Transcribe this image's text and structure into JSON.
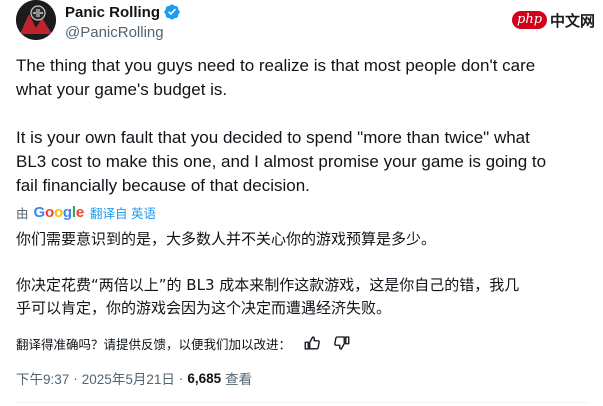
{
  "author": {
    "name": "Panic Rolling",
    "handle": "@PanicRolling",
    "verified": true
  },
  "watermark": {
    "php": "php",
    "cn": "中文网"
  },
  "tweet": {
    "text": "The thing that you guys need to realize is that most people don't care\nwhat your game's budget is.\n\nIt is your own fault that you decided to spend \"more than twice\" what\nBL3 cost to make this one, and I almost promise your game is going to\nfail financially because of that decision."
  },
  "translation": {
    "by_prefix": "由",
    "provider_icon": "google-logo",
    "link_label": "翻译自 英语",
    "text": "你们需要意识到的是，大多数人并不关心你的游戏预算是多少。\n\n你决定花费“两倍以上”的 BL3 成本来制作这款游戏，这是你自己的错，我几\n乎可以肯定，你的游戏会因为这个决定而遭遇经济失败。",
    "feedback_question": "翻译得准确吗？请提供反馈，以便我们加以改进："
  },
  "meta": {
    "time": "下午9:37",
    "separator": "·",
    "date": "2025年5月21日",
    "views_count": "6,685",
    "views_label": "查看"
  },
  "colors": {
    "text_primary": "#0f1419",
    "text_secondary": "#536471",
    "link": "#1d9bf0",
    "verified": "#1d9bf0"
  }
}
